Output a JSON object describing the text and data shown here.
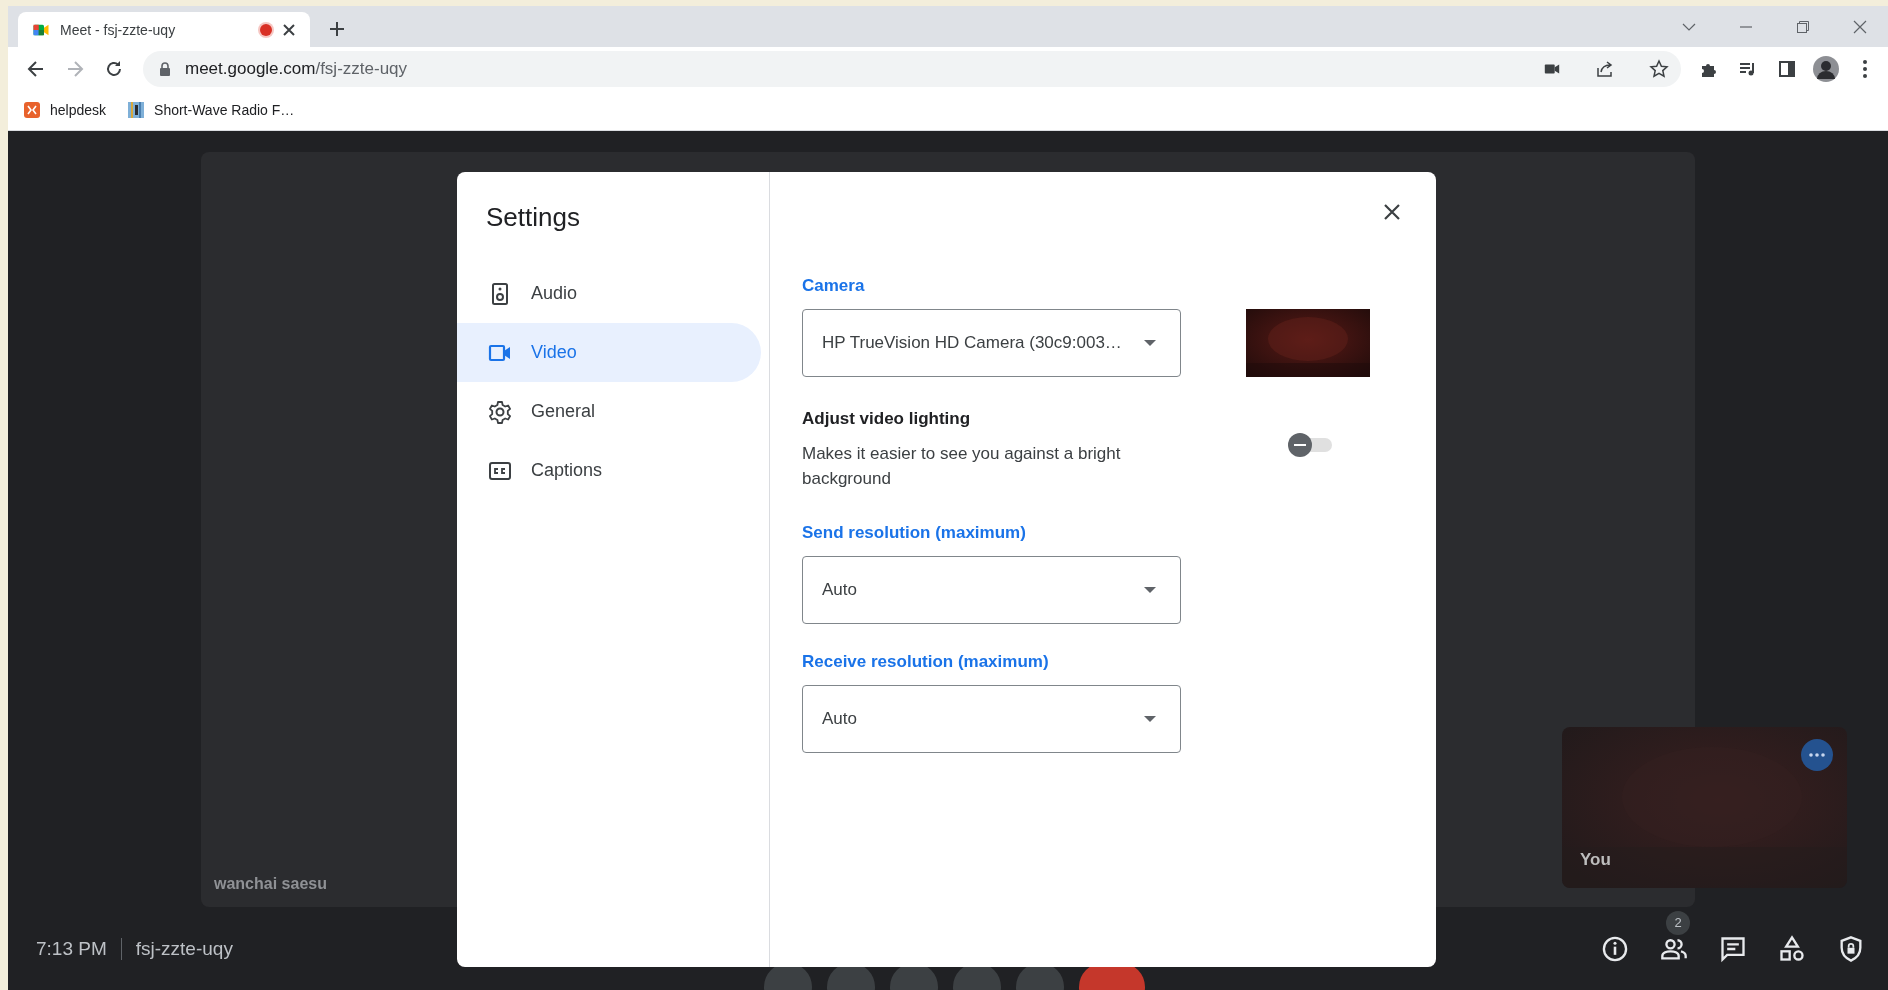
{
  "browser": {
    "tab": {
      "title": "Meet - fsj-zzte-uqy",
      "recording": true
    },
    "address": {
      "host": "meet.google.com",
      "path": "/fsj-zzte-uqy"
    },
    "bookmarks": [
      {
        "label": "helpdesk"
      },
      {
        "label": "Short-Wave Radio F…"
      }
    ]
  },
  "meeting": {
    "participant_name": "wanchai saesu",
    "self_label": "You",
    "time": "7:13 PM",
    "meeting_code": "fsj-zzte-uqy",
    "participants_badge": "2"
  },
  "settings": {
    "title": "Settings",
    "nav": [
      {
        "label": "Audio",
        "kind": "audio",
        "selected": false
      },
      {
        "label": "Video",
        "kind": "video",
        "selected": true
      },
      {
        "label": "General",
        "kind": "general",
        "selected": false
      },
      {
        "label": "Captions",
        "kind": "captions",
        "selected": false
      }
    ],
    "sections": [
      {
        "kind": "select",
        "label": "Camera",
        "value": "HP TrueVision HD Camera (30c9:003…",
        "preview": true
      },
      {
        "kind": "toggle",
        "title": "Adjust video lighting",
        "description": "Makes it easier to see you against a bright background",
        "on": false
      },
      {
        "kind": "select",
        "label": "Send resolution (maximum)",
        "value": "Auto"
      },
      {
        "kind": "select",
        "label": "Receive resolution (maximum)",
        "value": "Auto"
      }
    ]
  }
}
